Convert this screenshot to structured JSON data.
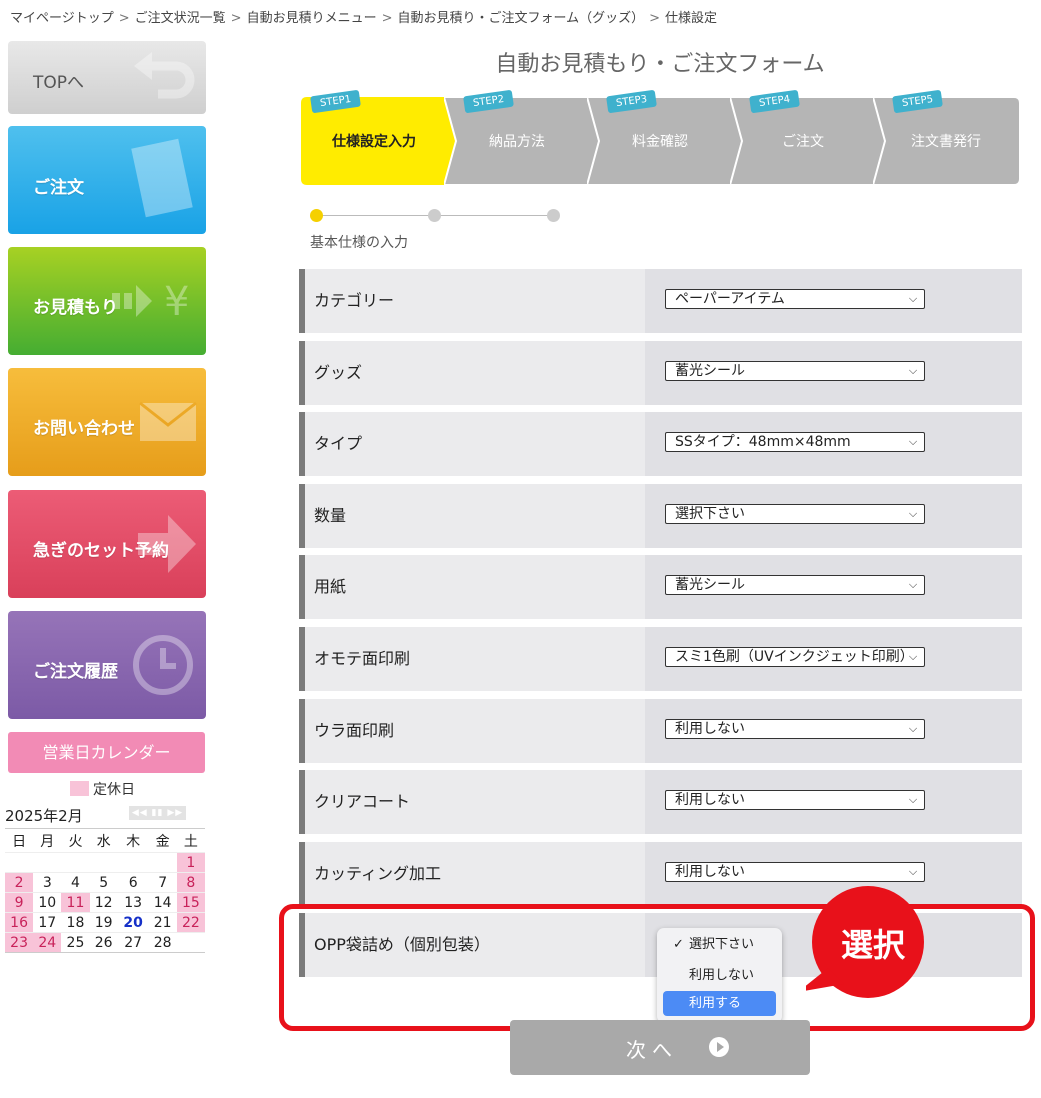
{
  "breadcrumb": [
    "マイページトップ",
    "ご注文状況一覧",
    "自動お見積りメニュー",
    "自動お見積り・ご注文フォーム（グッズ）",
    "仕様設定"
  ],
  "breadcrumb_separator": ">",
  "sidebar": {
    "top": "TOPへ",
    "order": "ご注文",
    "quote": "お見積もり",
    "contact": "お問い合わせ",
    "rush": "急ぎのセット予約",
    "history": "ご注文履歴"
  },
  "calendar": {
    "title": "営業日カレンダー",
    "legend": "定休日",
    "month": "2025年2月",
    "nav": "◀◀ ▮▮ ▶▶",
    "weekdays": [
      "日",
      "月",
      "火",
      "水",
      "木",
      "金",
      "土"
    ],
    "weeks": [
      [
        "",
        "",
        "",
        "",
        "",
        "",
        "1"
      ],
      [
        "2",
        "3",
        "4",
        "5",
        "6",
        "7",
        "8"
      ],
      [
        "9",
        "10",
        "11",
        "12",
        "13",
        "14",
        "15"
      ],
      [
        "16",
        "17",
        "18",
        "19",
        "20",
        "21",
        "22"
      ],
      [
        "23",
        "24",
        "25",
        "26",
        "27",
        "28",
        ""
      ]
    ],
    "holidays": [
      "1",
      "2",
      "8",
      "9",
      "11",
      "15",
      "16",
      "22",
      "23",
      "24"
    ],
    "today": "20"
  },
  "form": {
    "title": "自動お見積もり・ご注文フォーム",
    "steps": [
      {
        "tag": "STEP1",
        "name": "仕様設定入力"
      },
      {
        "tag": "STEP2",
        "name": "納品方法"
      },
      {
        "tag": "STEP3",
        "name": "料金確認"
      },
      {
        "tag": "STEP4",
        "name": "ご注文"
      },
      {
        "tag": "STEP5",
        "name": "注文書発行"
      }
    ],
    "section_label": "基本仕様の入力",
    "rows": [
      {
        "label": "カテゴリー",
        "value": "ペーパーアイテム"
      },
      {
        "label": "グッズ",
        "value": "蓄光シール"
      },
      {
        "label": "タイプ",
        "value": "SSタイプ：48mm×48mm"
      },
      {
        "label": "数量",
        "value": "選択下さい"
      },
      {
        "label": "用紙",
        "value": "蓄光シール"
      },
      {
        "label": "オモテ面印刷",
        "value": "スミ1色刷（UVインクジェット印刷）"
      },
      {
        "label": "ウラ面印刷",
        "value": "利用しない"
      },
      {
        "label": "クリアコート",
        "value": "利用しない"
      },
      {
        "label": "カッティング加工",
        "value": "利用しない"
      },
      {
        "label": "OPP袋詰め（個別包装）",
        "value": ""
      }
    ],
    "dropdown_options": [
      "選択下さい",
      "利用しない",
      "利用する"
    ],
    "badge": "選択",
    "next": "次へ"
  },
  "colors": {
    "active_step": "#ffec00",
    "inactive_step": "#b5b5b5",
    "highlight": "#e8111a",
    "holiday": "#f8c3d8"
  }
}
